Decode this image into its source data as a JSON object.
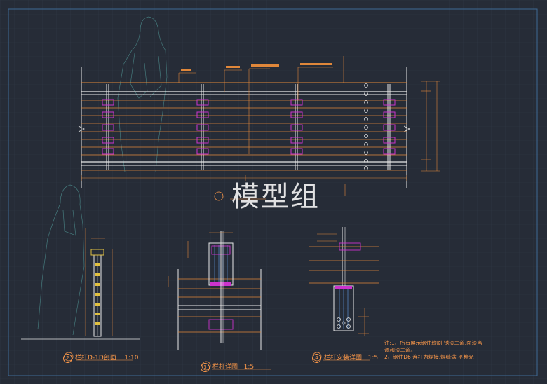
{
  "watermark": "模型组",
  "detail_labels": {
    "d2_num": "2",
    "d2_text": "栏杆D-1D剖面",
    "d2_scale": "1:10",
    "d3_num": "3",
    "d3_text": "栏杆详图",
    "d3_scale": "1:5",
    "d4_num": "4",
    "d4_text": "栏杆安装详图",
    "d4_scale": "1:5"
  },
  "notes": {
    "line1": "注:1、所有展示钢件均刷 锈漆二道,面漆当",
    "line2": "调和漆二道。",
    "line3": "2、钢件D6 连杆为焊接,焊缝满    平整光"
  },
  "colors": {
    "background": "#262c37",
    "grid": "#2f3744",
    "frame": "#3a5f8a",
    "white_line": "#e8e8e8",
    "orange": "#e0873a",
    "magenta": "#cc33cc",
    "figure": "#5aa0a0"
  }
}
